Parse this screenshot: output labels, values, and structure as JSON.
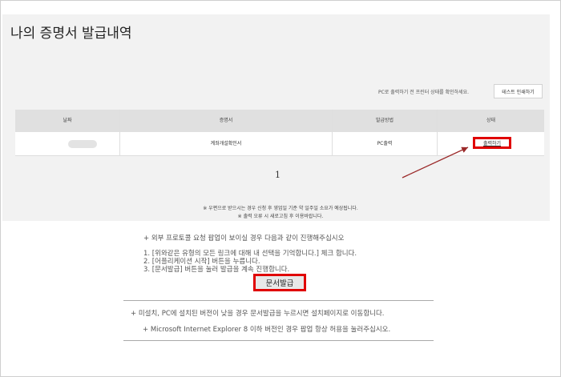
{
  "page": {
    "title": "나의 증명서 발급내역"
  },
  "toolbar": {
    "hint": "PC로 출력하기 전 프린터 상태를 확인하세요.",
    "test_print_label": "테스트 인쇄하기"
  },
  "table": {
    "headers": [
      "날짜",
      "증명서",
      "발급방법",
      "상태"
    ],
    "rows": [
      {
        "date": "",
        "certificate": "계좌개설확인서",
        "method": "PC출력",
        "status": "출력하기"
      }
    ]
  },
  "pagination": {
    "current": "1"
  },
  "notes": [
    "※ 우편으로 받으시는 경우 신청 후 영업일 기준 약 일주일 소요가 예상됩니다.",
    "※ 출력 오류 시 새로고침 후 이용바랍니다."
  ],
  "popup_instructions": {
    "heading": "+ 외부 프로토콜 요청 팝업이 보이실 경우 다음과 같이 진행해주십시오",
    "steps": [
      "1. [위와같은 유형의 모든 링크에 대해 내 선택을 기억합니다.] 체크 합니다.",
      "2. [어플리케이션 시작] 버튼을 누릅니다.",
      "3. [문서발급] 버튼을 눌러 발급을 계속 진행합니다."
    ],
    "issue_button": "문서발급"
  },
  "footer_notes": [
    "+ 미설치, PC에 설치된 버전이 낮을 경우 문서발급을 누르시면 설치페이지로 이동합니다.",
    "+ Microsoft Internet Explorer 8 이하 버전인 경우 팝업 항상 허용을 눌러주십시오."
  ],
  "colors": {
    "highlight": "#e00000",
    "arrow": "#9b2a2a",
    "panel": "#f2f2f2"
  }
}
